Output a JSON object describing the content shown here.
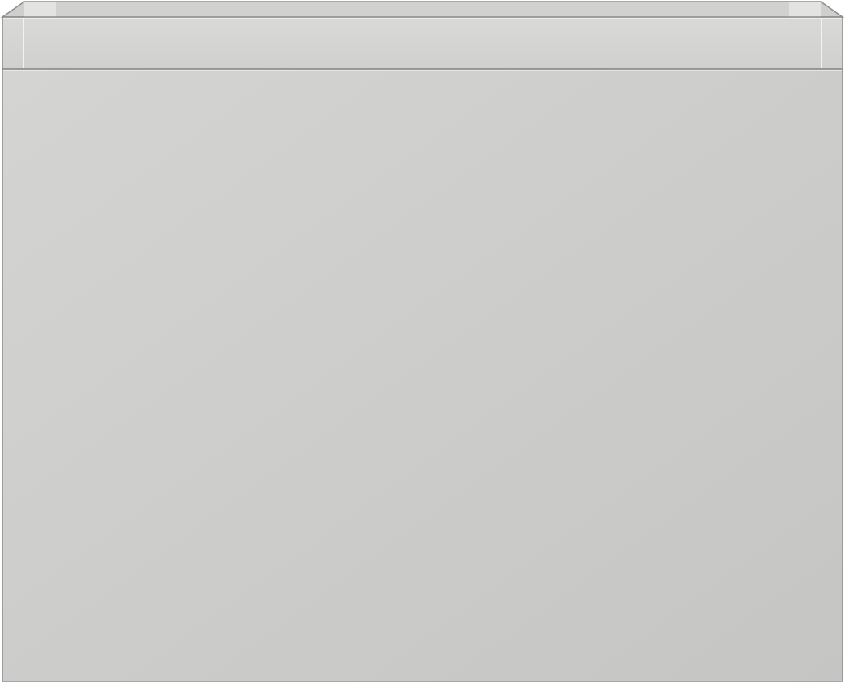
{
  "image": {
    "subject": "",
    "colors": {
      "background": "#ffffff",
      "outline": "#8c8c8c",
      "front_light": "#d3d3d1",
      "front_dark": "#c6c6c4",
      "top_rim": "#d7d7d5",
      "inner_back": "#cfcfcd",
      "inner_side": "#e2e2e0",
      "edge_highlight": "#f2f2f0"
    }
  }
}
